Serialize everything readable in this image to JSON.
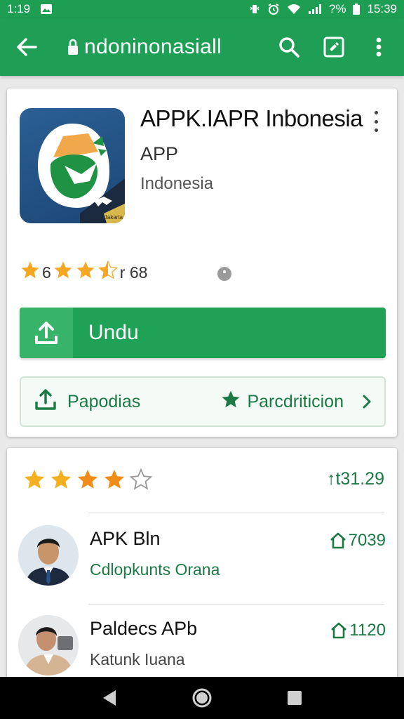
{
  "statusbar": {
    "time_left": "1:19",
    "signal_text": "?%",
    "time_right": "15:39"
  },
  "appbar": {
    "url": "ndoninonasiall",
    "icons": [
      "back-arrow-icon",
      "lock-icon",
      "search-icon",
      "edit-icon",
      "more-vert-icon"
    ]
  },
  "app": {
    "title": "APPK.IAPR Inbonesia",
    "subtitle": "APP",
    "developer": "Indonesia",
    "rating_left": "6",
    "rating_right": "r 68",
    "badge_text": "Jakarta"
  },
  "buttons": {
    "download": "Undu",
    "share": "Papodias",
    "prediction": "Parcdriticion"
  },
  "reviews_summary": {
    "stars_filled": 4,
    "stars_total": 5,
    "count": "↑t31.29"
  },
  "reviews": [
    {
      "name": "APK Bln",
      "sub": "Cdlopkunts Orana",
      "count": "7039"
    },
    {
      "name": "Paldecs APb",
      "sub": "Katunk Iuana",
      "count": "1120"
    }
  ],
  "colors": {
    "primary": "#1f9f55",
    "accent_green": "#1b7a44",
    "star": "#f5a623"
  }
}
